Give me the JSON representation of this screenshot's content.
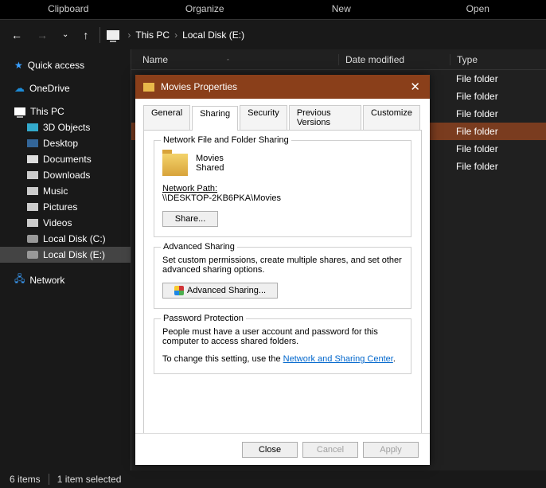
{
  "ribbon": {
    "tabs": [
      "Clipboard",
      "Organize",
      "New",
      "Open"
    ]
  },
  "breadcrumb": {
    "root": "This PC",
    "path": "Local Disk (E:)"
  },
  "tree": {
    "quick_access": "Quick access",
    "onedrive": "OneDrive",
    "this_pc": "This PC",
    "items": [
      "3D Objects",
      "Desktop",
      "Documents",
      "Downloads",
      "Music",
      "Pictures",
      "Videos",
      "Local Disk (C:)",
      "Local Disk (E:)"
    ],
    "network": "Network"
  },
  "columns": {
    "name": "Name",
    "date": "Date modified",
    "type": "Type"
  },
  "rows": [
    {
      "type": "File folder",
      "selected": false
    },
    {
      "type": "File folder",
      "selected": false
    },
    {
      "type": "File folder",
      "selected": false
    },
    {
      "type": "File folder",
      "selected": true
    },
    {
      "type": "File folder",
      "selected": false
    },
    {
      "type": "File folder",
      "selected": false
    }
  ],
  "status": {
    "items": "6 items",
    "selected": "1 item selected"
  },
  "dialog": {
    "title": "Movies Properties",
    "tabs": {
      "general": "General",
      "sharing": "Sharing",
      "security": "Security",
      "prev": "Previous Versions",
      "cust": "Customize"
    },
    "nfs": {
      "legend": "Network File and Folder Sharing",
      "name": "Movies",
      "state": "Shared",
      "netpath_label": "Network Path:",
      "netpath_value": "\\\\DESKTOP-2KB6PKA\\Movies",
      "share_btn": "Share..."
    },
    "adv": {
      "legend": "Advanced Sharing",
      "desc": "Set custom permissions, create multiple shares, and set other advanced sharing options.",
      "btn": "Advanced Sharing..."
    },
    "pwd": {
      "legend": "Password Protection",
      "desc": "People must have a user account and password for this computer to access shared folders.",
      "change_prefix": "To change this setting, use the ",
      "link": "Network and Sharing Center",
      "suffix": "."
    },
    "footer": {
      "close": "Close",
      "cancel": "Cancel",
      "apply": "Apply"
    }
  }
}
